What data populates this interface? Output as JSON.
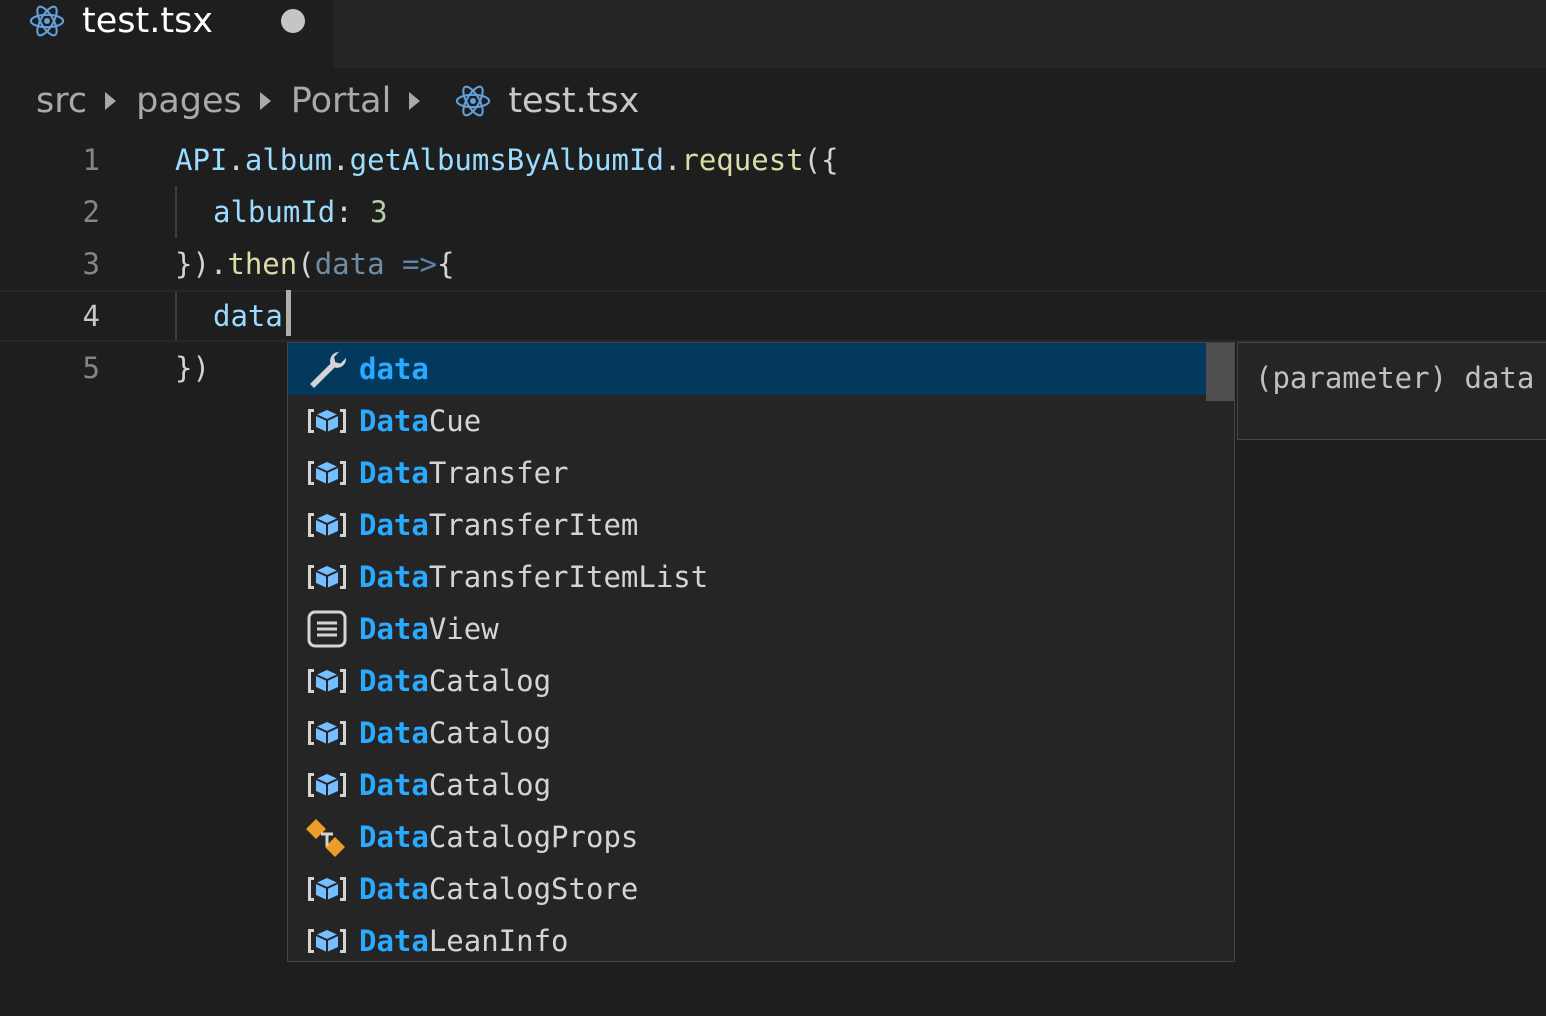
{
  "tab": {
    "label": "test.tsx",
    "icon": "react-icon",
    "dirty": true
  },
  "breadcrumb": {
    "items": [
      "src",
      "pages",
      "Portal"
    ],
    "file": "test.tsx"
  },
  "editor": {
    "lines": [
      {
        "number": "1",
        "current": false
      },
      {
        "number": "2",
        "current": false
      },
      {
        "number": "3",
        "current": false
      },
      {
        "number": "4",
        "current": true
      },
      {
        "number": "5",
        "current": false
      }
    ],
    "line1": {
      "api": "API",
      "dot1": ".",
      "album": "album",
      "dot2": ".",
      "getAlbums": "getAlbumsByAlbumId",
      "dot3": ".",
      "request": "request",
      "open": "({"
    },
    "line2": {
      "key": "albumId",
      "colon": ": ",
      "value": "3"
    },
    "line3": {
      "close": "})",
      "dot": ".",
      "then": "then",
      "paren": "(",
      "param": "data",
      "arrow": " =>",
      "brace": "{"
    },
    "line4": {
      "typed": "data"
    },
    "line5": {
      "close": "})"
    }
  },
  "suggest": {
    "items": [
      {
        "match": "data",
        "rest": "",
        "icon": "wrench-icon",
        "kind": "variable",
        "selected": true
      },
      {
        "match": "Data",
        "rest": "Cue",
        "icon": "class-icon",
        "kind": "class"
      },
      {
        "match": "Data",
        "rest": "Transfer",
        "icon": "class-icon",
        "kind": "class"
      },
      {
        "match": "Data",
        "rest": "TransferItem",
        "icon": "class-icon",
        "kind": "class"
      },
      {
        "match": "Data",
        "rest": "TransferItemList",
        "icon": "class-icon",
        "kind": "class"
      },
      {
        "match": "Data",
        "rest": "View",
        "icon": "interface-icon",
        "kind": "interface"
      },
      {
        "match": "Data",
        "rest": "Catalog",
        "icon": "class-icon",
        "kind": "class"
      },
      {
        "match": "Data",
        "rest": "Catalog",
        "icon": "class-icon",
        "kind": "class"
      },
      {
        "match": "Data",
        "rest": "Catalog",
        "icon": "class-icon",
        "kind": "class"
      },
      {
        "match": "Data",
        "rest": "CatalogProps",
        "icon": "type-parameter-icon",
        "kind": "type"
      },
      {
        "match": "Data",
        "rest": "CatalogStore",
        "icon": "class-icon",
        "kind": "class"
      },
      {
        "match": "Data",
        "rest": "LeanInfo",
        "icon": "class-icon",
        "kind": "class"
      }
    ]
  },
  "details": {
    "text": "(parameter) data"
  },
  "colors": {
    "background": "#1e1e1e",
    "selection": "#04395e",
    "match": "#2aaaff",
    "class_icon": "#75beff",
    "type_icon": "#ee9d28"
  }
}
